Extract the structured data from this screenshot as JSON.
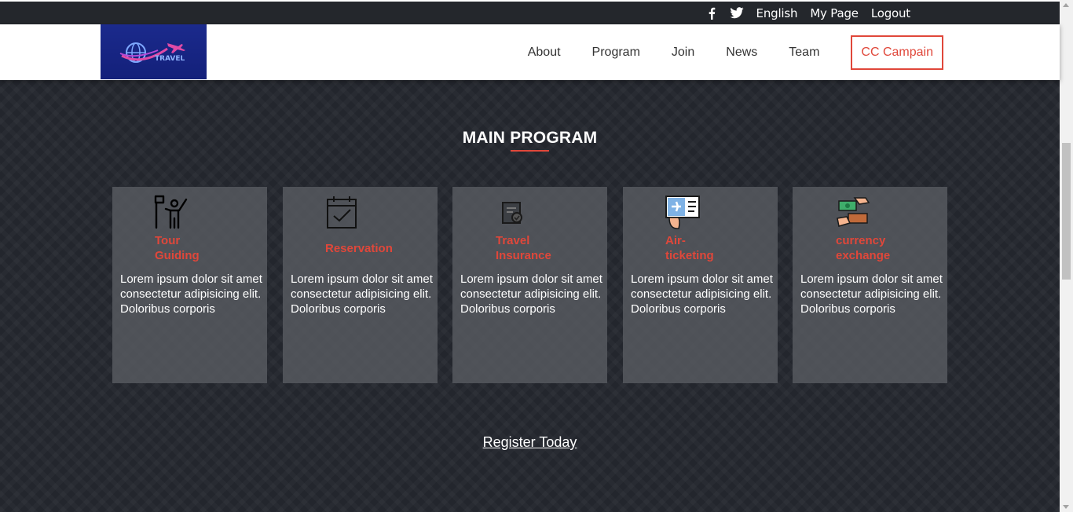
{
  "topbar": {
    "icons": [
      "facebook-icon",
      "twitter-icon"
    ],
    "links": [
      "English",
      "My Page",
      "Logout"
    ]
  },
  "navbar": {
    "logo_text": "TRAVEL",
    "menu": [
      "About",
      "Program",
      "Join",
      "News",
      "Team"
    ],
    "cta": "CC Campain"
  },
  "main": {
    "title": "MAIN PROGRAM",
    "cards": [
      {
        "icon": "tour-guide-icon",
        "title_lines": [
          "Tour",
          "Guiding"
        ],
        "text": "Lorem ipsum dolor sit amet consectetur adipisicing elit. Doloribus corporis"
      },
      {
        "icon": "calendar-check-icon",
        "title_lines": [
          "Reservation"
        ],
        "text": "Lorem ipsum dolor sit amet consectetur adipisicing elit. Doloribus corporis"
      },
      {
        "icon": "insurance-document-icon",
        "title_lines": [
          "Travel",
          "Insurance"
        ],
        "text": "Lorem ipsum dolor sit amet consectetur adipisicing elit. Doloribus corporis"
      },
      {
        "icon": "air-ticket-icon",
        "title_lines": [
          "Air-",
          "ticketing"
        ],
        "text": "Lorem ipsum dolor sit amet consectetur adipisicing elit. Doloribus corporis"
      },
      {
        "icon": "money-exchange-icon",
        "title_lines": [
          "currency",
          "exchange"
        ],
        "text": "Lorem ipsum dolor sit amet consectetur adipisicing elit. Doloribus corporis"
      }
    ],
    "register": "Register Today"
  },
  "colors": {
    "accent": "#e0473a",
    "topbar_bg": "#24272c",
    "section_bg": "#23262d",
    "card_bg": "#585b60"
  }
}
